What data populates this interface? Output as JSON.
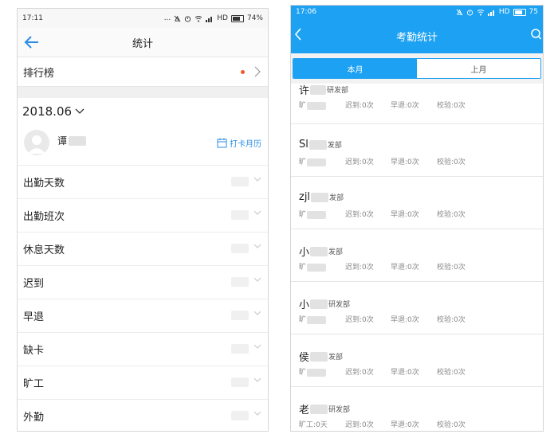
{
  "left": {
    "status": {
      "time": "17:11",
      "icons": "... ",
      "hd": "HD",
      "battery": "74%"
    },
    "nav": {
      "title": "统计"
    },
    "ranking": {
      "label": "排行榜"
    },
    "month": {
      "label": "2018.06"
    },
    "user": {
      "name_prefix": "谭"
    },
    "calendar_link": "打卡月历",
    "rows": [
      {
        "label": "出勤天数"
      },
      {
        "label": "出勤班次"
      },
      {
        "label": "休息天数"
      },
      {
        "label": "迟到"
      },
      {
        "label": "早退"
      },
      {
        "label": "缺卡"
      },
      {
        "label": "旷工"
      },
      {
        "label": "外勤"
      }
    ]
  },
  "right": {
    "status": {
      "time": "17:06",
      "hd": "HD",
      "battery": "75"
    },
    "nav": {
      "title": "考勤统计"
    },
    "tabs": [
      {
        "label": "本月"
      },
      {
        "label": "上月"
      }
    ],
    "items": [
      {
        "name": "许",
        "dept": "研发部",
        "absent": "旷",
        "late": "迟到:0次",
        "early": "早退:0次",
        "check": "校验:0次"
      },
      {
        "name": "Sl",
        "dept": "发部",
        "absent": "旷",
        "late": "迟到:0次",
        "early": "早退:0次",
        "check": "校验:0次"
      },
      {
        "name": "zjl",
        "dept": "发部",
        "absent": "旷",
        "late": "迟到:0次",
        "early": "早退:0次",
        "check": "校验:0次"
      },
      {
        "name": "小",
        "dept": "发部",
        "absent": "旷",
        "late": "迟到:0次",
        "early": "早退:0次",
        "check": "校验:0次"
      },
      {
        "name": "小",
        "dept": "研发部",
        "absent": "旷",
        "late": "迟到:0次",
        "early": "早退:0次",
        "check": "校验:0次"
      },
      {
        "name": "侯",
        "dept": "发部",
        "absent": "旷",
        "late": "迟到:0次",
        "early": "早退:0次",
        "check": "校验:0次"
      },
      {
        "name": "老",
        "dept": "研发部",
        "absent": "旷工:0天",
        "late": "迟到:0次",
        "early": "早退:0次",
        "check": "校验:0次"
      }
    ]
  }
}
